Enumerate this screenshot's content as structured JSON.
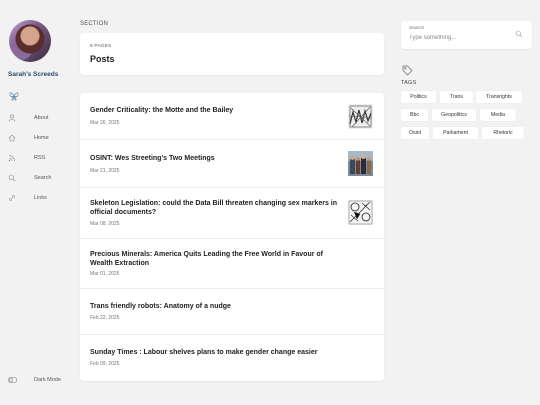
{
  "site": {
    "title": "Sarah's Screeds"
  },
  "nav": [
    {
      "label": "About"
    },
    {
      "label": "Home"
    },
    {
      "label": "RSS"
    },
    {
      "label": "Search"
    },
    {
      "label": "Links"
    }
  ],
  "dark_mode_label": "Dark Mode",
  "section_label": "SECTION",
  "header": {
    "page_count": "6 PAGES",
    "title": "Posts"
  },
  "posts": [
    {
      "title": "Gender Criticality: the Motte and the Bailey",
      "date": "Mar 26, 2025"
    },
    {
      "title": "OSINT: Wes Streeting's Two Meetings",
      "date": "Mar 21, 2025"
    },
    {
      "title": "Skeleton Legislation: could the Data Bill threaten changing sex markers in official documents?",
      "date": "Mar 08, 2025"
    },
    {
      "title": "Precious Minerals: America Quits Leading the Free World in Favour of Wealth Extraction",
      "date": "Mar 01, 2025"
    },
    {
      "title": "Trans friendly robots: Anatomy of a nudge",
      "date": "Feb 22, 2025"
    },
    {
      "title": "Sunday Times : Labour shelves plans to make gender change easier",
      "date": "Feb 09, 2025"
    }
  ],
  "search": {
    "label": "Search",
    "placeholder": "Type something..."
  },
  "tags_label": "TAGS",
  "tags": [
    "Politics",
    "Trans",
    "Transrights",
    "Bbc",
    "Geopolitics",
    "Media",
    "Osint",
    "Parliament",
    "Rhetoric"
  ],
  "colors": {
    "site_title": "#2a4a6a",
    "background": "#f2f2f2"
  }
}
